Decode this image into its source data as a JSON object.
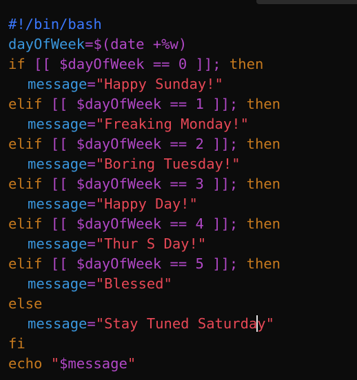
{
  "script": {
    "shebang": "#!/bin/bash",
    "day_var": "dayOfWeek",
    "assign_op": "=",
    "date_cmd": "$(date +%w)",
    "kw_if": "if",
    "kw_elif": "elif",
    "kw_else": "else",
    "kw_fi": "fi",
    "kw_then": "then",
    "test_open": "[[",
    "test_close": "]];",
    "day_ref": "$dayOfWeek",
    "eq_op": "==",
    "msg_var": "message",
    "branches": [
      {
        "num": "0",
        "text": "\"Happy Sunday!\""
      },
      {
        "num": "1",
        "text": "\"Freaking Monday!\""
      },
      {
        "num": "2",
        "text": "\"Boring Tuesday!\""
      },
      {
        "num": "3",
        "text": "\"Happy Day!\""
      },
      {
        "num": "4",
        "text": "\"Thur S Day!\""
      },
      {
        "num": "5",
        "text": "\"Blessed\""
      }
    ],
    "else_text_before_caret": "\"Stay Tuned Saturda",
    "else_text_after_caret": "y\"",
    "echo_cmd": "echo",
    "echo_quote_open": "\"",
    "echo_arg": "$message",
    "echo_quote_close": "\""
  },
  "colors": {
    "background": "#0c0c0c",
    "shebang": "#3b78ff",
    "variable": "#61d6d6",
    "keyword": "#c19c00",
    "bracket": "#b148c6",
    "string": "#e74856"
  }
}
